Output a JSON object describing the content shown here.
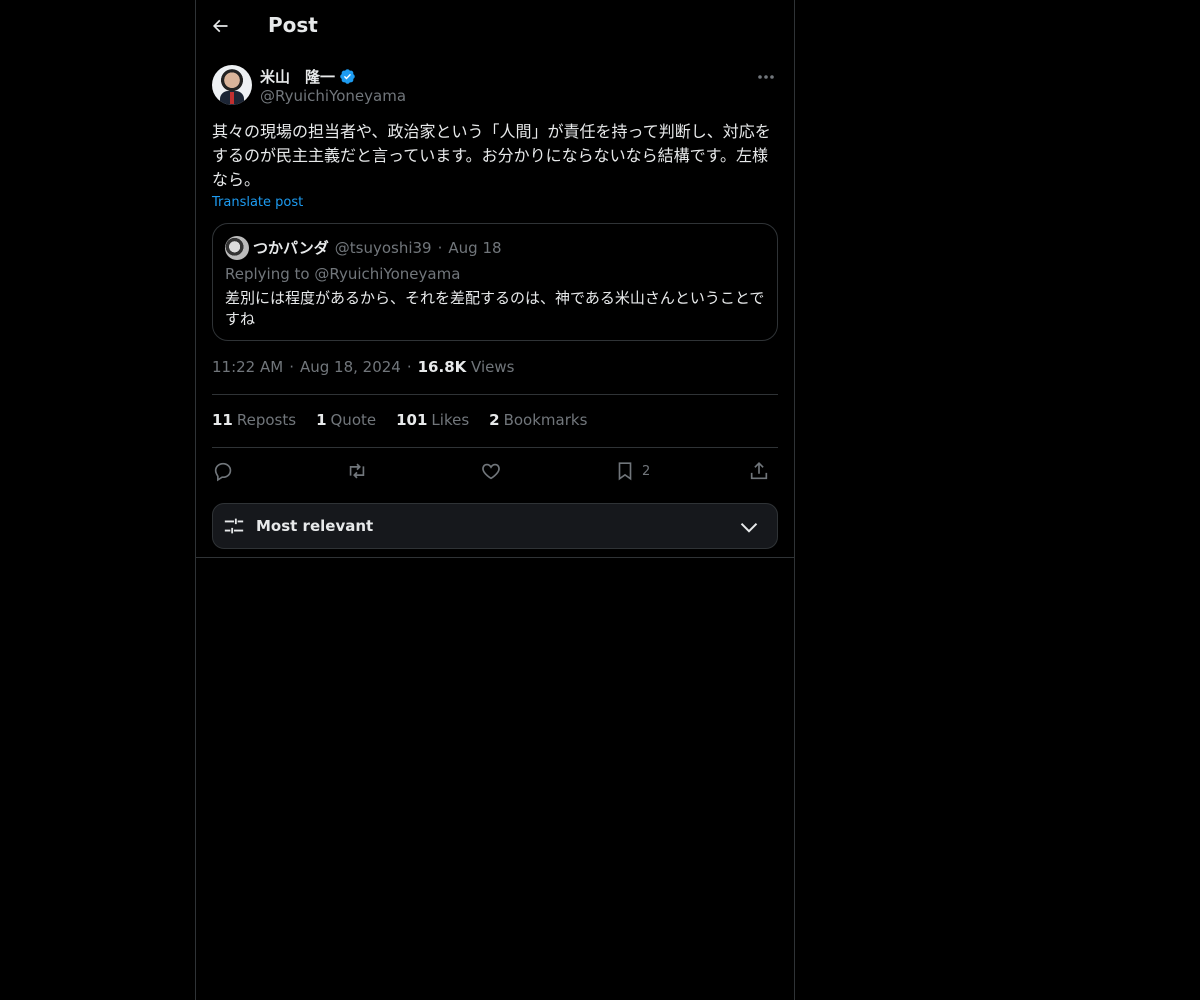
{
  "header": {
    "title": "Post",
    "back_icon": "arrow-left-icon"
  },
  "post": {
    "author_name": "米山　隆一",
    "author_handle": "@RyuichiYoneyama",
    "verified_color": "#1d9bf0",
    "text": "其々の現場の担当者や、政治家という「人間」が責任を持って判断し、対応をするのが民主主義だと言っています。お分かりにならないなら結構です。左様なら。",
    "translate_label": "Translate post",
    "time": "11:22 AM",
    "date": "Aug 18, 2024",
    "views_count": "16.8K",
    "views_label": "Views",
    "separator": "·"
  },
  "quote": {
    "name": "つかパンダ",
    "handle": "@tsuyoshi39",
    "date": "Aug 18",
    "replying_prefix": "Replying to",
    "replying_to": "@RyuichiYoneyama",
    "text": "差別には程度があるから、それを差配するのは、神である米山さんということですね"
  },
  "stats": {
    "reposts_count": "11",
    "reposts_label": "Reposts",
    "quote_count": "1",
    "quote_label": "Quote",
    "likes_count": "101",
    "likes_label": "Likes",
    "bookmarks_count": "2",
    "bookmarks_label": "Bookmarks"
  },
  "actions": {
    "bookmark_count": "2"
  },
  "sort": {
    "label": "Most relevant"
  }
}
